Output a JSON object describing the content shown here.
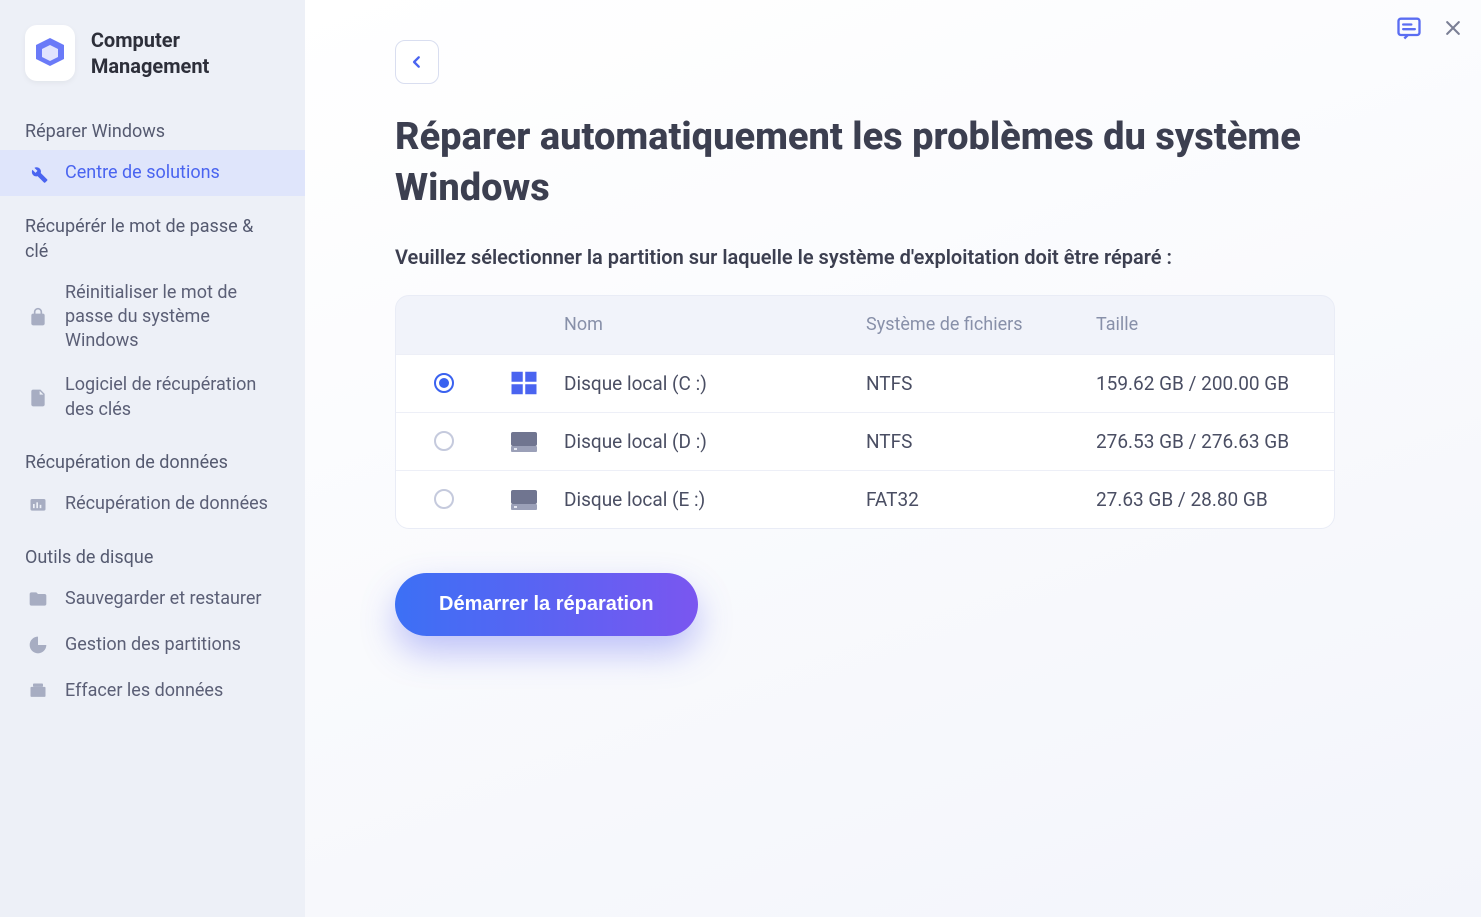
{
  "app": {
    "name": "Computer Management"
  },
  "sidebar": {
    "sections": [
      {
        "header": "Réparer Windows",
        "items": [
          {
            "label": "Centre de solutions",
            "icon": "wrench-icon",
            "active": true
          }
        ]
      },
      {
        "header": "Récupérér le mot de passe  & clé",
        "items": [
          {
            "label": "Réinitialiser le mot de passe du système Windows",
            "icon": "lock-icon"
          },
          {
            "label": "Logiciel de récupération des clés",
            "icon": "key-doc-icon"
          }
        ]
      },
      {
        "header": "Récupération de données",
        "items": [
          {
            "label": "Récupération de données",
            "icon": "data-recover-icon"
          }
        ]
      },
      {
        "header": "Outils de disque",
        "items": [
          {
            "label": "Sauvegarder et restaurer",
            "icon": "backup-icon"
          },
          {
            "label": "Gestion des partitions",
            "icon": "partition-icon"
          },
          {
            "label": "Effacer les données",
            "icon": "erase-icon"
          }
        ]
      }
    ]
  },
  "page": {
    "title": "Réparer automatiquement les problèmes du système Windows",
    "subtitle": "Veuillez sélectionner la partition sur laquelle le système d'exploitation doit être réparé :",
    "tableHeaders": {
      "name": "Nom",
      "fs": "Système de fichiers",
      "size": "Taille"
    },
    "partitions": [
      {
        "name": "Disque local (C :)",
        "fs": "NTFS",
        "size": "159.62 GB / 200.00 GB",
        "selected": true,
        "isWindows": true
      },
      {
        "name": "Disque local (D :)",
        "fs": "NTFS",
        "size": "276.53 GB / 276.63 GB",
        "selected": false,
        "isWindows": false
      },
      {
        "name": "Disque local (E :)",
        "fs": "FAT32",
        "size": "27.63 GB / 28.80 GB",
        "selected": false,
        "isWindows": false
      }
    ],
    "startButton": "Démarrer la réparation"
  }
}
